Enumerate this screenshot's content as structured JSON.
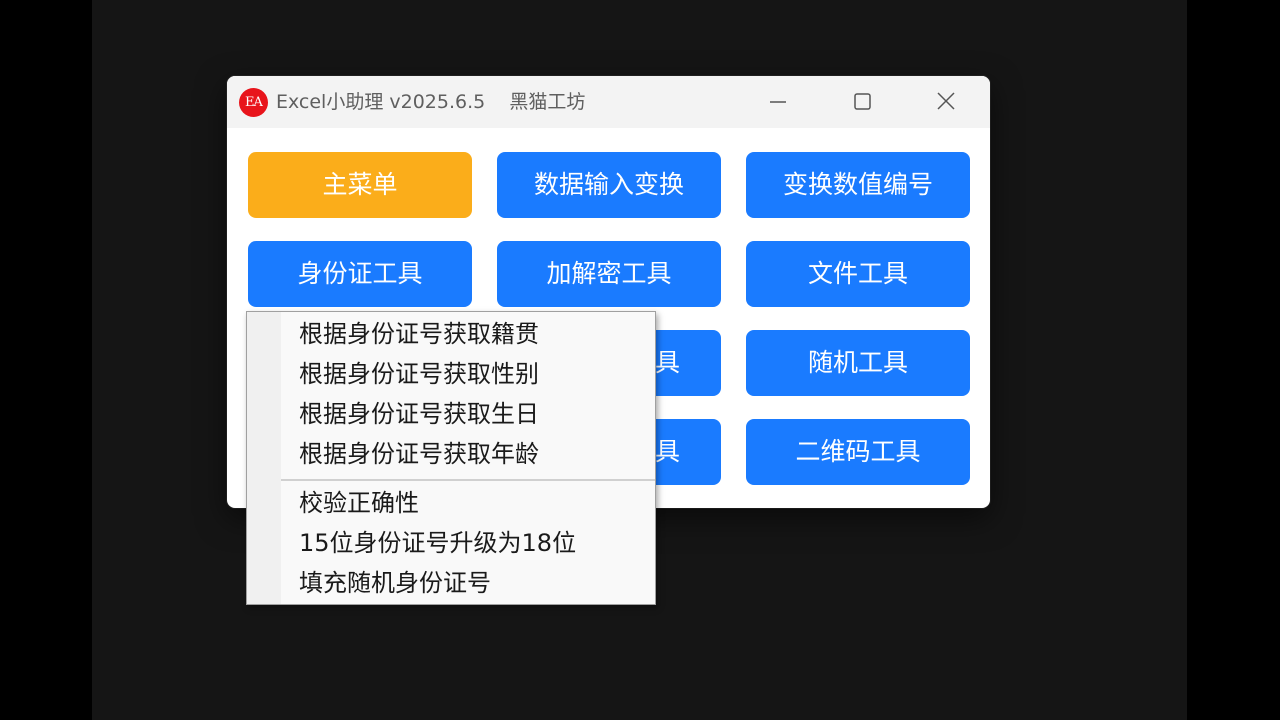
{
  "window": {
    "logo_text": "EA",
    "title": "Excel小助理 v2025.6.5    黑猫工坊",
    "controls": [
      "minimize-icon",
      "maximize-icon",
      "close-icon"
    ]
  },
  "buttons": {
    "main_menu": "主菜单",
    "data_input_transform": "数据输入变换",
    "transform_numbering": "变换数值编号",
    "id_card_tool": "身份证工具",
    "encrypt_decrypt_tool": "加解密工具",
    "file_tool": "文件工具",
    "row3_col2_visible_fragment": "具",
    "random_tool": "随机工具",
    "row4_col2_visible_fragment": "具",
    "qrcode_tool": "二维码工具"
  },
  "context_menu": {
    "items": [
      "根据身份证号获取籍贯",
      "根据身份证号获取性别",
      "根据身份证号获取生日",
      "根据身份证号获取年龄",
      "校验正确性",
      "15位身份证号升级为18位",
      "填充随机身份证号"
    ]
  },
  "colors": {
    "button_blue": "#1a7bff",
    "button_active_orange": "#fbad1a",
    "logo_red": "#e8141b",
    "titlebar_bg": "#f3f3f3",
    "page_bg": "#151515"
  }
}
